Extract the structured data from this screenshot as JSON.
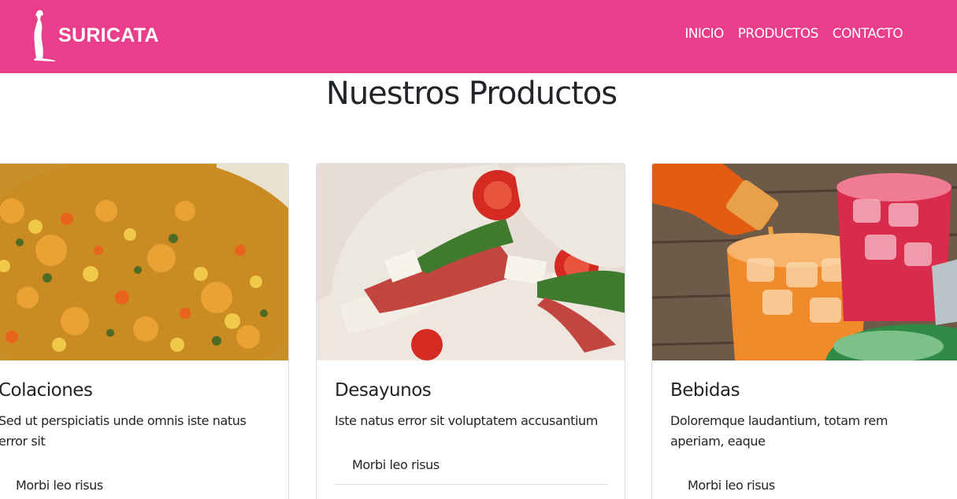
{
  "navbar": {
    "brand": "SURICATA",
    "brand_icon": "meerkat-logo",
    "links": [
      "INICIO",
      "PRODUCTOS",
      "CONTACTO"
    ],
    "color": "#e83e8c"
  },
  "page": {
    "title": "Nuestros Productos"
  },
  "cards": [
    {
      "title": "Colaciones",
      "text": "Sed ut perspiciatis unde omnis iste natus error sit",
      "list_item": "Morbi leo risus",
      "image": "vegetable-rice-photo"
    },
    {
      "title": "Desayunos",
      "text": "Iste natus error sit voluptatem accusantium",
      "list_item": "Morbi leo risus",
      "image": "pita-sandwich-photo"
    },
    {
      "title": "Bebidas",
      "text": "Doloremque laudantium, totam rem aperiam, eaque",
      "list_item": "Morbi leo risus",
      "image": "iced-drinks-photo"
    }
  ]
}
